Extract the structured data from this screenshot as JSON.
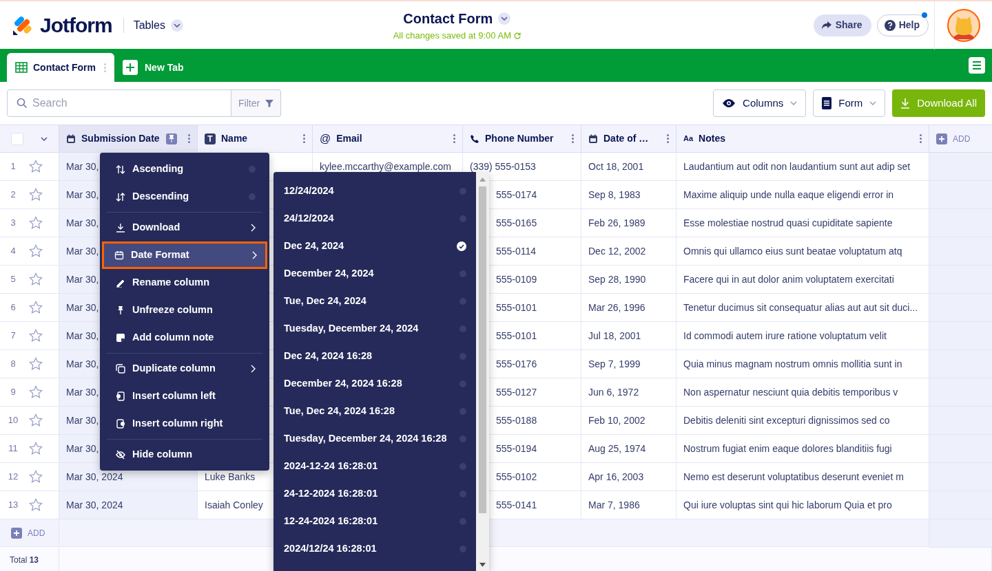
{
  "header": {
    "logo": "Jotform",
    "app": "Tables",
    "title": "Contact Form",
    "save_status": "All changes saved at 9:00 AM",
    "share": "Share",
    "help": "Help",
    "help_notification": true
  },
  "tabs": [
    {
      "label": "Contact Form",
      "selected": true
    }
  ],
  "new_tab": "New Tab",
  "toolbar": {
    "search": {
      "placeholder": "Search"
    },
    "filter": "Filter",
    "columns": "Columns",
    "form": "Form",
    "download_all": "Download All"
  },
  "table": {
    "select_all": {
      "checked": false
    },
    "columns": [
      {
        "label": "Submission Date",
        "kind": "date",
        "pinned": true
      },
      {
        "label": "Name",
        "kind": "text",
        "icon_text": "T",
        "pinned": false
      },
      {
        "label": "Email",
        "kind": "email",
        "icon_text": "@",
        "pinned": false
      },
      {
        "label": "Phone Number",
        "kind": "phone",
        "pinned": false
      },
      {
        "label": "Date of …",
        "kind": "date",
        "pinned": false
      },
      {
        "label": "Notes",
        "kind": "notes",
        "icon_text": "Aa",
        "pinned": false
      }
    ],
    "add_column": "ADD",
    "rows": [
      {
        "number": "1",
        "starred": false,
        "cells": [
          "Mar 30,",
          null,
          "kylee.mccarthy@example.com",
          "(339) 555-0153",
          "Oct 18, 2001",
          "Laudantium aut odit non laudantium sunt aut adip set"
        ]
      },
      {
        "number": "2",
        "starred": false,
        "cells": [
          "Mar 30,",
          null,
          null,
          "555-0174",
          "Sep 8, 1983",
          "Maxime aliquip unde nulla eaque eligendi error in"
        ]
      },
      {
        "number": "3",
        "starred": false,
        "cells": [
          "Mar 30,",
          null,
          null,
          "555-0165",
          "Feb 26, 1989",
          "Esse molestiae nostrud quasi cupiditate sapiente"
        ]
      },
      {
        "number": "4",
        "starred": false,
        "cells": [
          "Mar 30,",
          null,
          null,
          "555-0114",
          "Dec 12, 2002",
          "Omnis qui ullamco eius sunt beatae voluptatum atq"
        ]
      },
      {
        "number": "5",
        "starred": false,
        "cells": [
          "Mar 30,",
          null,
          null,
          "555-0109",
          "Sep 28, 1990",
          "Facere qui in aut dolor anim voluptatem exercitati"
        ]
      },
      {
        "number": "6",
        "starred": false,
        "cells": [
          "Mar 30,",
          null,
          null,
          "555-0101",
          "Mar 26, 1996",
          "Tenetur ducimus sit consequatur alias aut aut sit duci..."
        ]
      },
      {
        "number": "7",
        "starred": false,
        "cells": [
          "Mar 30,",
          null,
          null,
          "555-0101",
          "Jul 18, 2001",
          "Id commodi autem irure ratione voluptatum velit"
        ]
      },
      {
        "number": "8",
        "starred": false,
        "cells": [
          "Mar 30,",
          null,
          null,
          "555-0176",
          "Sep 7, 1999",
          "Quia minus magnam nostrum omnis mollitia sunt in"
        ]
      },
      {
        "number": "9",
        "starred": false,
        "cells": [
          "Mar 30,",
          null,
          null,
          "555-0127",
          "Jun 6, 1972",
          "Non aspernatur nesciunt quia debitis temporibus v"
        ]
      },
      {
        "number": "10",
        "starred": false,
        "cells": [
          "Mar 30,",
          null,
          null,
          "555-0188",
          "Feb 10, 2002",
          "Debitis deleniti sint excepturi dignissimos sed co"
        ]
      },
      {
        "number": "11",
        "starred": false,
        "cells": [
          "Mar 30,",
          null,
          null,
          "555-0194",
          "Aug 25, 1974",
          "Nostrum fugiat enim eaque dolores blanditiis fugi"
        ]
      },
      {
        "number": "12",
        "starred": false,
        "cells": [
          "Mar 30, 2024",
          "Luke Banks",
          null,
          "555-0102",
          "Apr 16, 2003",
          "Nemo est deserunt voluptatibus deserunt eveniet m"
        ]
      },
      {
        "number": "13",
        "starred": false,
        "cells": [
          "Mar 30, 2024",
          "Isaiah Conley",
          null,
          "555-0141",
          "Mar 7, 1986",
          "Qui iure voluptas sint qui hic laborum Quia et pro"
        ]
      }
    ],
    "add_row": "ADD",
    "total_label": "Total",
    "total_count": "13"
  },
  "column_menu": {
    "groups": [
      [
        {
          "label": "Ascending",
          "submenu": false,
          "selected": false,
          "highlighted": false
        },
        {
          "label": "Descending",
          "submenu": false,
          "selected": false,
          "highlighted": false
        }
      ],
      [
        {
          "label": "Download",
          "submenu": true,
          "highlighted": false
        },
        {
          "label": "Date Format",
          "submenu": true,
          "highlighted": true
        },
        {
          "label": "Rename column",
          "submenu": false,
          "highlighted": false
        },
        {
          "label": "Unfreeze column",
          "submenu": false,
          "highlighted": false
        },
        {
          "label": "Add column note",
          "submenu": false,
          "highlighted": false
        }
      ],
      [
        {
          "label": "Duplicate column",
          "submenu": true,
          "highlighted": false
        },
        {
          "label": "Insert column left",
          "submenu": false,
          "highlighted": false
        },
        {
          "label": "Insert column right",
          "submenu": false,
          "highlighted": false
        }
      ],
      [
        {
          "label": "Hide column",
          "submenu": false,
          "highlighted": false
        }
      ]
    ]
  },
  "date_format_menu": {
    "options": [
      {
        "label": "12/24/2024",
        "selected": false
      },
      {
        "label": "24/12/2024",
        "selected": false
      },
      {
        "label": "Dec 24, 2024",
        "selected": true
      },
      {
        "label": "December 24, 2024",
        "selected": false
      },
      {
        "label": "Tue, Dec 24, 2024",
        "selected": false
      },
      {
        "label": "Tuesday, December 24, 2024",
        "selected": false
      },
      {
        "label": "Dec 24, 2024 16:28",
        "selected": false
      },
      {
        "label": "December 24, 2024 16:28",
        "selected": false
      },
      {
        "label": "Tue, Dec 24, 2024 16:28",
        "selected": false
      },
      {
        "label": "Tuesday, December 24, 2024 16:28",
        "selected": false
      },
      {
        "label": "2024-12-24 16:28:01",
        "selected": false
      },
      {
        "label": "24-12-2024 16:28:01",
        "selected": false
      },
      {
        "label": "12-24-2024 16:28:01",
        "selected": false
      },
      {
        "label": "2024/12/24 16:28:01",
        "selected": false
      }
    ]
  }
}
